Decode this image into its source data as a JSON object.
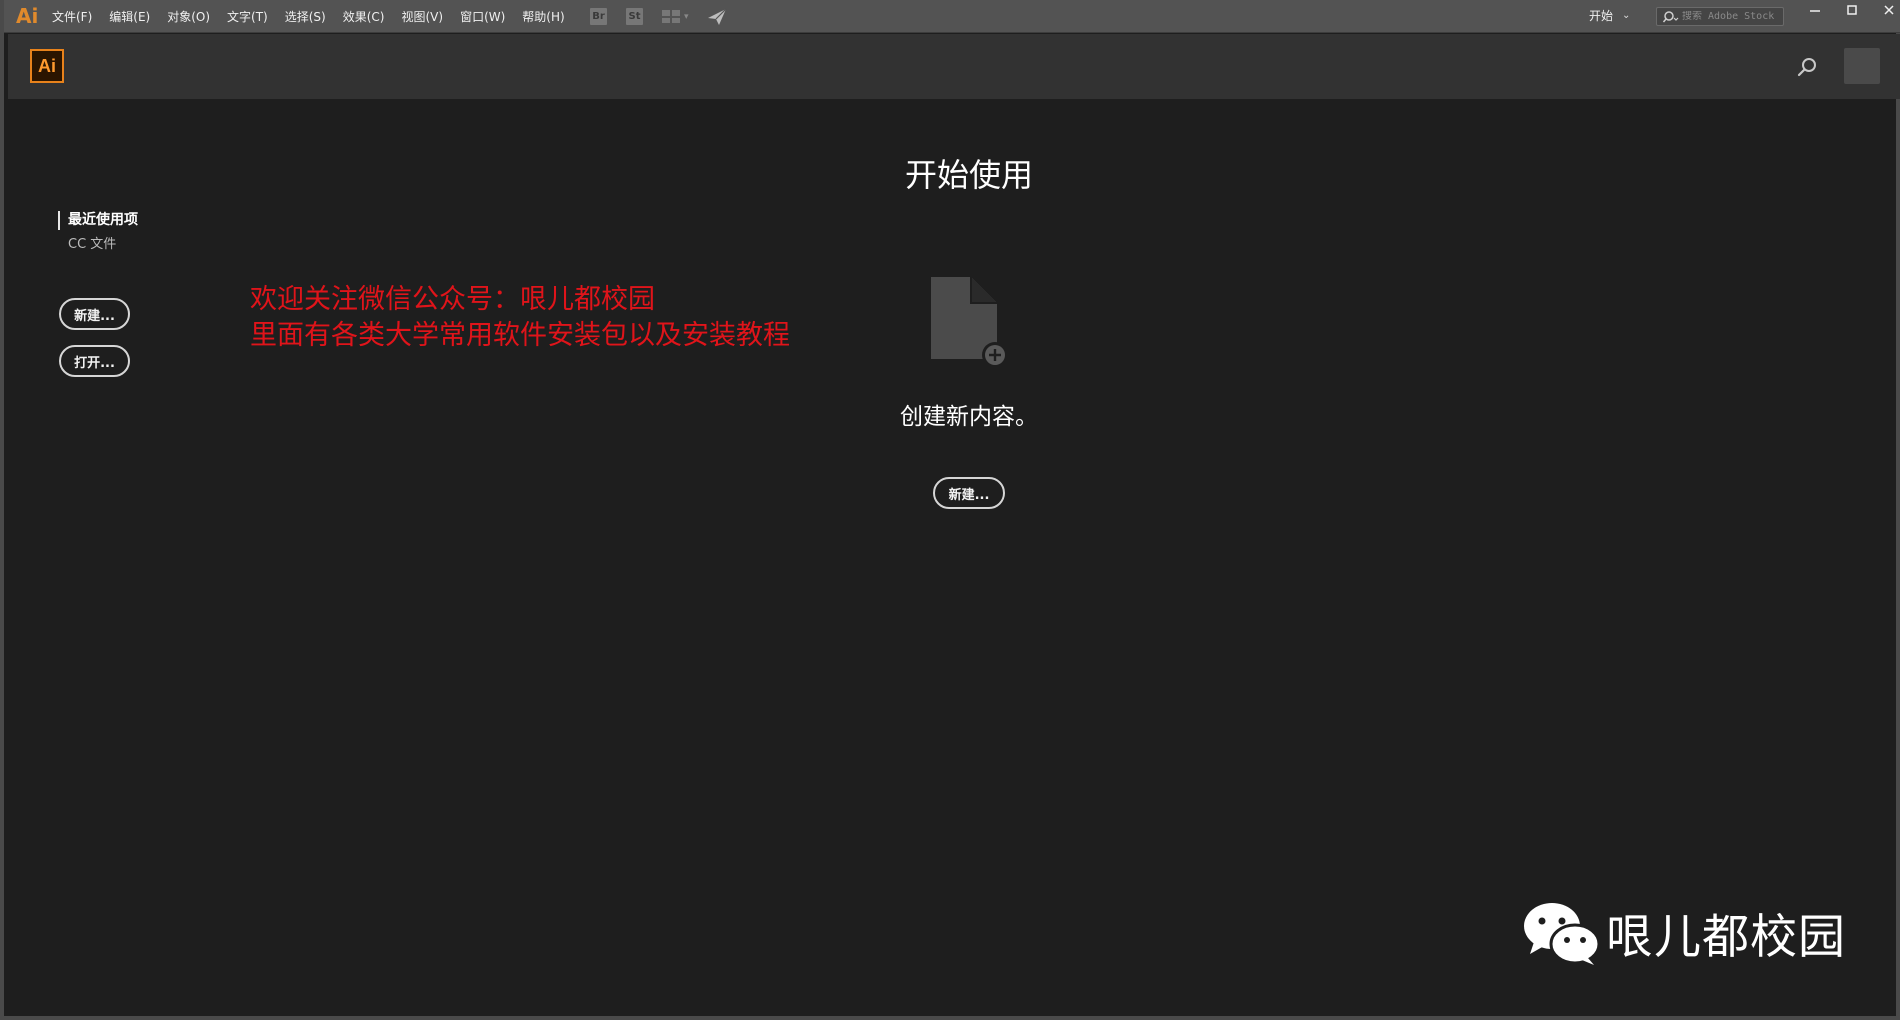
{
  "app": {
    "glyph": "Ai",
    "logo_text": "Ai"
  },
  "menubar": {
    "items": [
      "文件(F)",
      "编辑(E)",
      "对象(O)",
      "文字(T)",
      "选择(S)",
      "效果(C)",
      "视图(V)",
      "窗口(W)",
      "帮助(H)"
    ],
    "toolbar_icons": [
      "bridge-icon",
      "stock-icon",
      "arrange-documents-icon",
      "publish-rocket-icon"
    ],
    "bridge_label": "Br",
    "stock_label": "St",
    "workspace_label": "开始",
    "stock_search_placeholder": "搜索 Adobe Stock",
    "window_buttons": [
      "minimize-icon",
      "maximize-icon",
      "close-icon"
    ]
  },
  "header": {
    "icons": [
      "search-icon",
      "avatar"
    ]
  },
  "leftnav": {
    "items": [
      {
        "label": "最近使用项",
        "active": true
      },
      {
        "label": "CC 文件",
        "active": false
      }
    ],
    "new_button": "新建...",
    "open_button": "打开..."
  },
  "notice": {
    "line1": "欢迎关注微信公众号：哏儿都校园",
    "line2": "里面有各类大学常用软件安装包以及安装教程",
    "color": "#e0141a"
  },
  "main": {
    "title": "开始使用",
    "create_text": "创建新内容。",
    "new_button": "新建..."
  },
  "wechat": {
    "name": "哏儿都校园",
    "icon": "wechat-icon"
  },
  "colors": {
    "accent": "#e8821b",
    "background": "#1e1e1e",
    "header": "#323232",
    "menubar": "#535353"
  }
}
